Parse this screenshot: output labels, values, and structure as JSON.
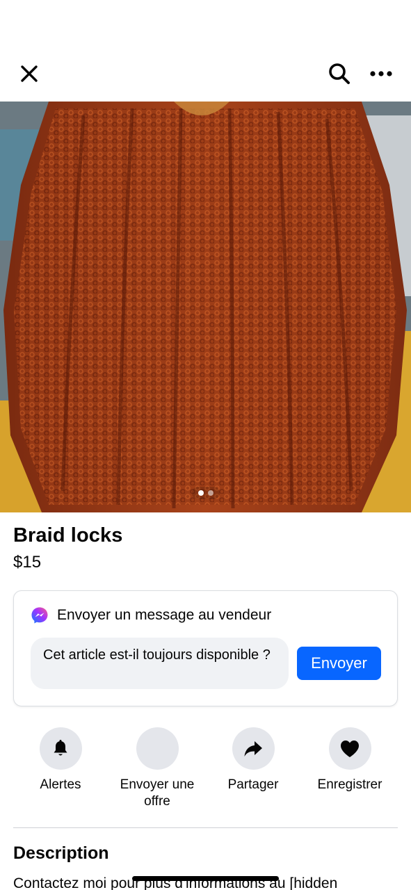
{
  "header": {
    "close_icon": "close-icon",
    "search_icon": "search-icon",
    "more_icon": "more-horizontal-icon"
  },
  "listing": {
    "photo_pagination": {
      "total": 2,
      "current": 1
    },
    "title": "Braid locks",
    "price": "$15"
  },
  "message_card": {
    "heading": "Envoyer un message au vendeur",
    "input_value": "Cet article est-il toujours disponible ?",
    "send_label": "Envoyer",
    "accent": "#0866ff"
  },
  "actions": [
    {
      "label": "Alertes",
      "icon": "bell-icon"
    },
    {
      "label": "Envoyer une offre",
      "icon": ""
    },
    {
      "label": "Partager",
      "icon": "share-arrow-icon"
    },
    {
      "label": "Enregistrer",
      "icon": "heart-icon"
    }
  ],
  "description": {
    "heading": "Description",
    "text": "Contactez moi pour plus d'informations au [hidden"
  }
}
